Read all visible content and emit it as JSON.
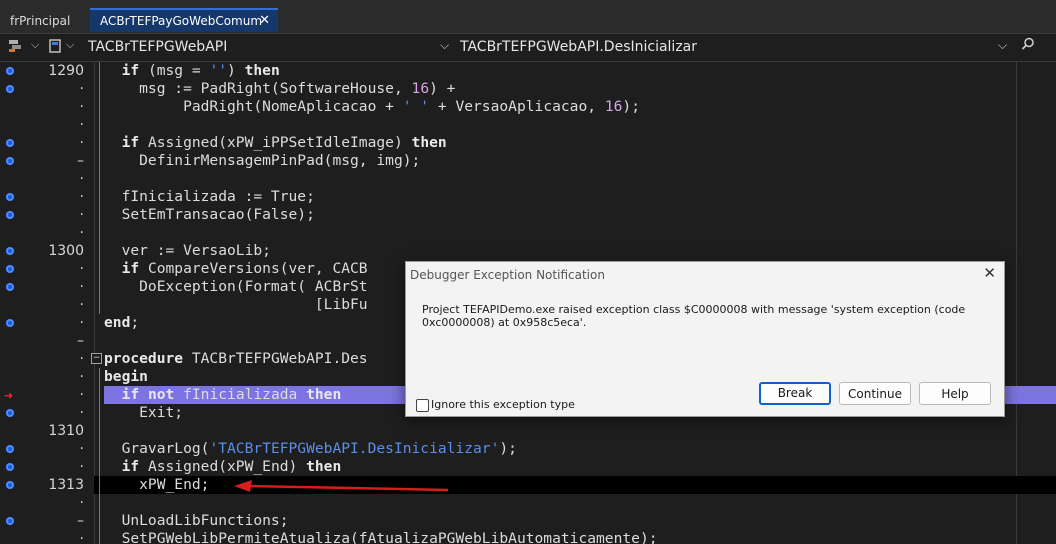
{
  "tabs": [
    {
      "label": "frPrincipal"
    },
    {
      "label": "ACBrTEFPayGoWebComum",
      "close": "✕"
    }
  ],
  "navigator": {
    "class_name": "TACBrTEFPGWebAPI",
    "method_name": "TACBrTEFPGWebAPI.DesInicializar"
  },
  "editor": {
    "lines": [
      {
        "num": "1290",
        "code": "  if (msg = '') then"
      },
      {
        "num": "·",
        "code": "    msg := PadRight(SoftwareHouse, 16) +"
      },
      {
        "num": "·",
        "code": "         PadRight(NomeAplicacao + ' ' + VersaoAplicacao, 16);"
      },
      {
        "num": "·",
        "code": ""
      },
      {
        "num": "·",
        "code": "  if Assigned(xPW_iPPSetIdleImage) then"
      },
      {
        "num": "–",
        "code": "    DefinirMensagemPinPad(msg, img);"
      },
      {
        "num": "·",
        "code": ""
      },
      {
        "num": "·",
        "code": "  fInicializada := True;"
      },
      {
        "num": "·",
        "code": "  SetEmTransacao(False);"
      },
      {
        "num": "·",
        "code": ""
      },
      {
        "num": "1300",
        "code": "  ver := VersaoLib;"
      },
      {
        "num": "·",
        "code": "  if CompareVersions(ver, CACB"
      },
      {
        "num": "·",
        "code": "    DoException(Format( ACBrSt"
      },
      {
        "num": "·",
        "code": "                        [LibFu"
      },
      {
        "num": "·",
        "code": "end;"
      },
      {
        "num": "–",
        "code": ""
      },
      {
        "num": "·",
        "code": "procedure TACBrTEFPGWebAPI.Des"
      },
      {
        "num": "·",
        "code": "begin"
      },
      {
        "num": "·",
        "code": "  if not fInicializada then"
      },
      {
        "num": "·",
        "code": "    Exit;"
      },
      {
        "num": "1310",
        "code": ""
      },
      {
        "num": "·",
        "code": "  GravarLog('TACBrTEFPGWebAPI.DesInicializar');"
      },
      {
        "num": "·",
        "code": "  if Assigned(xPW_End) then"
      },
      {
        "num": "1313",
        "code": "    xPW_End;"
      },
      {
        "num": "·",
        "code": ""
      },
      {
        "num": "–",
        "code": "  UnLoadLibFunctions;"
      },
      {
        "num": "·",
        "code": "  SetPGWebLibPermiteAtualiza(fAtualizaPGWebLibAutomaticamente);"
      }
    ]
  },
  "dialog": {
    "title": "Debugger Exception Notification",
    "close": "✕",
    "message": "Project TEFAPIDemo.exe raised exception class $C0000008 with message 'system exception (code 0xc0000008) at 0x958c5eca'.",
    "ignore_label": "Ignore this exception type",
    "ignore_checked": false,
    "buttons": {
      "break": "Break",
      "continue": "Continue",
      "help": "Help"
    }
  }
}
